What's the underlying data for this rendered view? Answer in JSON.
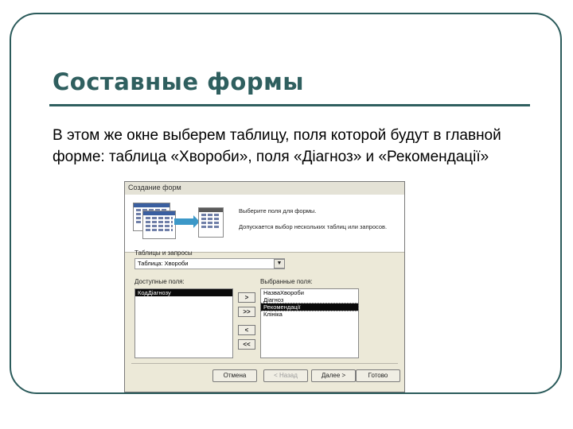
{
  "slide": {
    "title": "Составные формы",
    "body": "В этом же окне выберем таблицу, поля которой будут в главной форме: таблица «Хвороби», поля «Діагноз» и «Рекомендації»"
  },
  "dialog": {
    "title": "Создание форм",
    "hint_select": "Выберите поля для формы.",
    "hint_multi": "Допускается выбор нескольких таблиц или запросов.",
    "tables_label": "Таблицы и запросы",
    "table_value": "Таблица: Хвороби",
    "available_label": "Доступные поля:",
    "selected_label": "Выбранные поля:",
    "available_fields": [
      "КодДіагнозу"
    ],
    "selected_fields": [
      "НазваХвороби",
      "Діагноз",
      "Рекомендації",
      "Клініка"
    ],
    "move_buttons": {
      "one": ">",
      "all": ">>",
      "back_one": "<",
      "back_all": "<<"
    },
    "buttons": {
      "cancel": "Отмена",
      "back": "< Назад",
      "next": "Далее >",
      "finish": "Готово"
    }
  },
  "colors": {
    "accent": "#2f5f5f",
    "dialog_bg": "#ece9d8",
    "highlight": "#0a0a0a"
  }
}
